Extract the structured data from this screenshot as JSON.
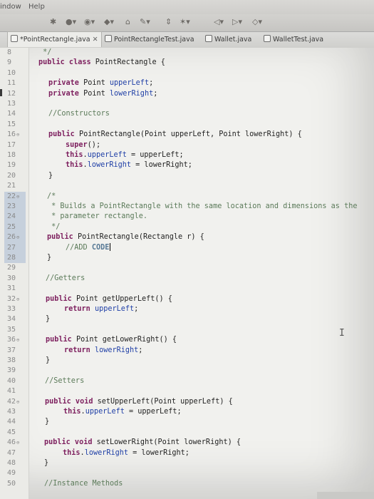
{
  "menu": {
    "window": "indow",
    "help": "Help"
  },
  "tabs": [
    {
      "label": "*PointRectangle.java",
      "active": true,
      "closable": true
    },
    {
      "label": "PointRectangleTest.java",
      "active": false
    },
    {
      "label": "Wallet.java",
      "active": false
    },
    {
      "label": "WalletTest.java",
      "active": false
    }
  ],
  "editor": {
    "close_glyph": "✕",
    "lines": [
      {
        "n": "8"
      },
      {
        "n": "9"
      },
      {
        "n": "10"
      },
      {
        "n": "11"
      },
      {
        "n": "12"
      },
      {
        "n": "13"
      },
      {
        "n": "14"
      },
      {
        "n": "15"
      },
      {
        "n": "16"
      },
      {
        "n": "17"
      },
      {
        "n": "18"
      },
      {
        "n": "19"
      },
      {
        "n": "20"
      },
      {
        "n": "21"
      },
      {
        "n": "22"
      },
      {
        "n": "23"
      },
      {
        "n": "24"
      },
      {
        "n": "25"
      },
      {
        "n": "26"
      },
      {
        "n": "27"
      },
      {
        "n": "28"
      },
      {
        "n": "29"
      },
      {
        "n": "30"
      },
      {
        "n": "31"
      },
      {
        "n": "32"
      },
      {
        "n": "33"
      },
      {
        "n": "34"
      },
      {
        "n": "35"
      },
      {
        "n": "36"
      },
      {
        "n": "37"
      },
      {
        "n": "38"
      },
      {
        "n": "39"
      },
      {
        "n": "40"
      },
      {
        "n": "41"
      },
      {
        "n": "42"
      },
      {
        "n": "43"
      },
      {
        "n": "44"
      },
      {
        "n": "45"
      },
      {
        "n": "46"
      },
      {
        "n": "47"
      },
      {
        "n": "48"
      },
      {
        "n": "49"
      },
      {
        "n": "50"
      }
    ],
    "tokens": {
      "l8": {
        "a": " */"
      },
      "l9": {
        "k1": "public class",
        "t1": " PointRectangle {"
      },
      "l11": {
        "k1": "private",
        "t1": " Point ",
        "f1": "upperLeft",
        "t2": ";"
      },
      "l12": {
        "k1": "private",
        "t1": " Point ",
        "f1": "lowerRight",
        "t2": ";"
      },
      "l14": {
        "c1": "//Constructors"
      },
      "l16": {
        "k1": "public",
        "t1": " PointRectangle(Point upperLeft, Point lowerRight) {"
      },
      "l17": {
        "k1": "super",
        "t1": "();"
      },
      "l18": {
        "k1": "this",
        "t1": ".",
        "f1": "upperLeft",
        "t2": " = upperLeft;"
      },
      "l19": {
        "k1": "this",
        "t1": ".",
        "f1": "lowerRight",
        "t2": " = lowerRight;"
      },
      "l20": {
        "t1": "}"
      },
      "l22": {
        "c1": "/*"
      },
      "l23": {
        "c1": " * Builds a PointRectangle with the same location and dimensions as the"
      },
      "l24": {
        "c1": " * parameter rectangle."
      },
      "l25": {
        "c1": " */"
      },
      "l26": {
        "k1": "public",
        "t1": " PointRectangle(Rectangle r) {"
      },
      "l27": {
        "c1": "//ADD ",
        "c2": "CODE"
      },
      "l28": {
        "t1": "}"
      },
      "l30": {
        "c1": "//Getters"
      },
      "l32": {
        "k1": "public",
        "t1": " Point getUpperLeft() {"
      },
      "l33": {
        "k1": "return",
        "f1": " upperLeft",
        "t2": ";"
      },
      "l34": {
        "t1": "}"
      },
      "l36": {
        "k1": "public",
        "t1": " Point getLowerRight() {"
      },
      "l37": {
        "k1": "return",
        "f1": " lowerRight",
        "t2": ";"
      },
      "l38": {
        "t1": "}"
      },
      "l40": {
        "c1": "//Setters"
      },
      "l42": {
        "k1": "public void",
        "t1": " setUpperLeft(Point upperLeft) {"
      },
      "l43": {
        "k1": "this",
        "t1": ".",
        "f1": "upperLeft",
        "t2": " = upperLeft;"
      },
      "l44": {
        "t1": "}"
      },
      "l46": {
        "k1": "public void",
        "t1": " setLowerRight(Point lowerRight) {"
      },
      "l47": {
        "k1": "this",
        "t1": ".",
        "f1": "lowerRight",
        "t2": " = lowerRight;"
      },
      "l48": {
        "t1": "}"
      },
      "l50": {
        "c1": "//Instance Methods"
      }
    },
    "ibeam": "I"
  },
  "colors": {
    "keyword": "#7d1f5e",
    "field": "#1f3fa6",
    "comment": "#5b7a59",
    "editor_bg": "#f1f1ee"
  }
}
